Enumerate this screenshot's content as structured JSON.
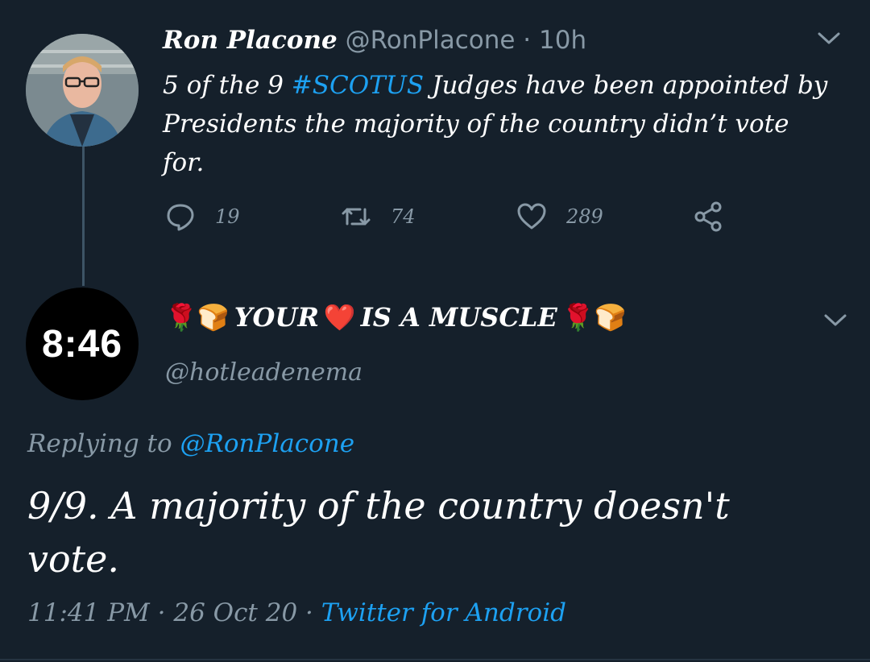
{
  "tweet1": {
    "name": "Ron Placone",
    "handle": "@RonPlacone",
    "separator": "·",
    "time": "10h",
    "text_before": "5 of the 9 ",
    "hashtag": "#SCOTUS",
    "text_after": " Judges have been appointed by Presidents the majority of the country didn’t vote for.",
    "actions": {
      "replies": "19",
      "retweets": "74",
      "likes": "289"
    }
  },
  "tweet2": {
    "avatar_text": "8:46",
    "name_prefix_emojis": "🌹🍞",
    "name_part1": "YOUR",
    "name_heart": "❤️",
    "name_part2": "IS A MUSCLE",
    "name_suffix_emojis": "🌹🍞",
    "handle": "@hotleadenema",
    "replying_label": "Replying to",
    "replying_handle": "@RonPlacone",
    "text": "9/9. A majority of the country doesn't vote.",
    "timestamp": "11:41 PM · 26 Oct 20 · ",
    "source": "Twitter for Android"
  },
  "colors": {
    "background": "#15202b",
    "accent": "#1da1f2",
    "muted": "#8899a6",
    "thread_line": "#3d5466"
  }
}
